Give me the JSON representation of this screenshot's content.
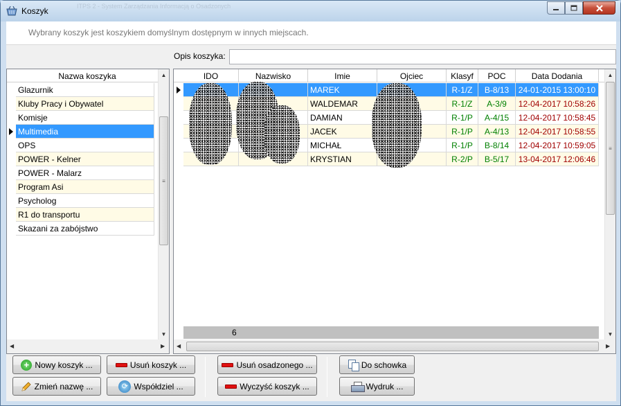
{
  "window": {
    "title": "Koszyk",
    "background_title": "ITPS 2 - System Zarządzania Informacją o Osadzonych"
  },
  "info_text": "Wybrany koszyk jest koszykiem domyślnym dostępnym w innych miejscach.",
  "opis": {
    "label": "Opis koszyka:",
    "value": ""
  },
  "left_grid": {
    "header": "Nazwa koszyka",
    "selected_index": 3,
    "items": [
      "Glazurnik",
      "Kluby Pracy i Obywatel",
      "Komisje",
      "Multimedia",
      "OPS",
      "POWER - Kelner",
      "POWER - Malarz",
      "Program Asi",
      "Psycholog",
      "R1 do transportu",
      "Skazani za zabójstwo"
    ]
  },
  "right_grid": {
    "columns": [
      "IDO",
      "Nazwisko",
      "Imie",
      "Ojciec",
      "Klasyf",
      "POC",
      "Data Dodania"
    ],
    "rows": [
      {
        "imie": "MAREK",
        "klasyf": "R-1/Z",
        "poc": "B-8/13",
        "data": "24-01-2015 13:00:10"
      },
      {
        "imie": "WALDEMAR",
        "klasyf": "R-1/Z",
        "poc": "A-3/9",
        "data": "12-04-2017 10:58:26"
      },
      {
        "imie": "DAMIAN",
        "klasyf": "R-1/P",
        "poc": "A-4/15",
        "data": "12-04-2017 10:58:45"
      },
      {
        "imie": "JACEK",
        "klasyf": "R-1/P",
        "poc": "A-4/13",
        "data": "12-04-2017 10:58:55"
      },
      {
        "imie": "MICHAŁ",
        "klasyf": "R-1/P",
        "poc": "B-8/14",
        "data": "12-04-2017 10:59:05"
      },
      {
        "imie": "KRYSTIAN",
        "klasyf": "R-2/P",
        "poc": "B-5/17",
        "data": "13-04-2017 12:06:46"
      }
    ],
    "count": "6"
  },
  "buttons": {
    "nowy": "Nowy koszyk ...",
    "usun_koszyk": "Usuń koszyk ...",
    "zmien": "Zmień nazwę ...",
    "wspoldziel": "Współdziel ...",
    "usun_osadzonego": "Usuń osadzonego ...",
    "wyczysc": "Wyczyść koszyk ...",
    "do_schowka": "Do schowka",
    "wydruk": "Wydruk ..."
  },
  "icons": {
    "title": "basket-icon",
    "minimize": "minimize-icon",
    "maximize": "maximize-icon",
    "close": "close-icon"
  },
  "colors": {
    "selection": "#3399ff",
    "alt_row": "#fffbe6",
    "klasyf": "#008000",
    "date": "#a00000",
    "close_button": "#c74f3a"
  }
}
